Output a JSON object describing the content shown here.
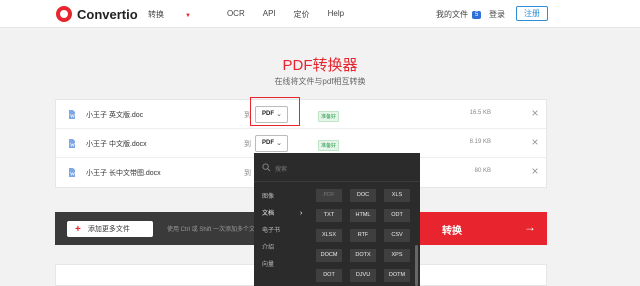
{
  "header": {
    "logo_text": "Convertio",
    "nav": {
      "convert": "转换",
      "ocr": "OCR",
      "api": "API",
      "pricing": "定价",
      "help": "Help"
    },
    "my_files": "我的文件",
    "my_files_count": "5",
    "login": "登录",
    "signup": "注册"
  },
  "hero": {
    "title": "PDF转换器",
    "subtitle": "在线将文件与pdf相互转换"
  },
  "files": [
    {
      "name": "小王子 英文版.doc",
      "to": "到",
      "format": "PDF",
      "status": "准备好",
      "size": "16.5 KB"
    },
    {
      "name": "小王子 中文版.docx",
      "to": "到",
      "format": "PDF",
      "status": "准备好",
      "size": "8.19 KB"
    },
    {
      "name": "小王子 长中文带图.docx",
      "to": "到",
      "format": "",
      "status": "",
      "size": "80 KB"
    }
  ],
  "actions": {
    "add_more": "添加更多文件",
    "hint": "使用 Ctrl 或 Shift 一次添加多个文件",
    "convert": "转换"
  },
  "dropdown": {
    "search_placeholder": "搜索",
    "categories": [
      "图像",
      "文档",
      "电子书",
      "介绍",
      "向量"
    ],
    "active_category": "文档",
    "formats": [
      "PDF",
      "DOC",
      "XLS",
      "TXT",
      "HTML",
      "ODT",
      "XLSX",
      "RTF",
      "CSV",
      "DOCM",
      "DOTX",
      "XPS",
      "DOT",
      "DJVU",
      "DOTM"
    ],
    "disabled_format": "PDF"
  },
  "colors": {
    "brand_red": "#e8242f",
    "dark_panel": "#2b2b2b",
    "status_green": "#2a9a4a",
    "link_blue": "#2f8fd8"
  },
  "icons": [
    "convertio-logo-icon",
    "chevron-down-icon",
    "file-icon",
    "close-icon",
    "plus-icon",
    "arrow-right-icon",
    "search-icon",
    "chevron-right-icon"
  ]
}
